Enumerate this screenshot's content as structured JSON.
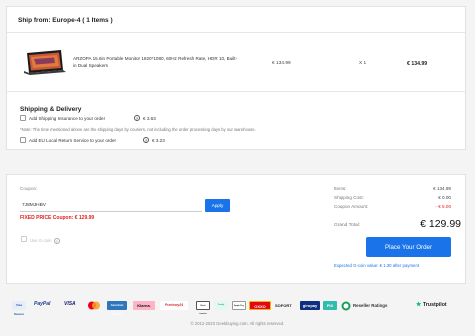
{
  "shipping_group": {
    "title": "Ship from: Europe-4 ( 1 Items )"
  },
  "product": {
    "name": "ARZOPA 15.6in Portable Monitor 1920*1080, 60Hz Refresh Rate, HDR 10, Built-in Dual Speakers",
    "unit_price": "€ 134.99",
    "quantity": "X 1",
    "total": "€ 134.99"
  },
  "shipping_delivery": {
    "title": "Shipping & Delivery",
    "insurance_label": "Add Shipping Insurance to your order",
    "insurance_price": "€ 3.63",
    "note": "*Note: The time mentioned above are the shipping days by couriers, not including the order processing days by our warehouse.",
    "return_label": "Add EU Local Return Service to your order",
    "return_price": "€ 3.23"
  },
  "coupon": {
    "label": "Coupon:",
    "value": "7J8MJHBV",
    "apply_label": "Apply",
    "fixed_price_text": "FIXED PRICE Coupon: € 129.99"
  },
  "gcoin": {
    "label": "Use G-coin"
  },
  "summary": {
    "items_label": "Items:",
    "items_value": "€ 134.99",
    "shipping_label": "Shipping Cost:",
    "shipping_value": "€ 0.00",
    "coupon_label": "Coupon Amount:",
    "coupon_value": "- € 5.00",
    "grand_total_label": "Grand Total:",
    "grand_total_value": "€ 129.99",
    "place_order_label": "Place Your Order",
    "expected_gcoin": "Expected G-coin value: € 1.30 after payment"
  },
  "payments": [
    "Visa Secure",
    "PayPal",
    "VISA",
    "Mastercard",
    "American Express",
    "Klarna.",
    "Przelewy24",
    "Bank transfer",
    "Trustly",
    "Apple Pay",
    "OXXO",
    "SOFORT",
    "giropay",
    "PIX",
    "Reseller Ratings",
    "Trustpilot"
  ],
  "colors": {
    "accent": "#1a73e8",
    "danger": "#e02020"
  },
  "footer": {
    "copyright": "© 2012-2023 Geekbuying.com. All rights reserved."
  }
}
